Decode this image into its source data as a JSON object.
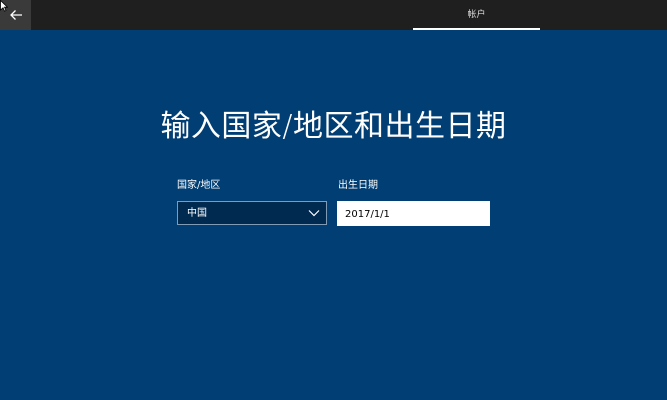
{
  "topbar": {
    "back_icon": "arrow-left-icon",
    "tab_label": "帐户"
  },
  "main": {
    "title": "输入国家/地区和出生日期",
    "country": {
      "label": "国家/地区",
      "selected_value": "中国",
      "dropdown_icon": "chevron-down-icon"
    },
    "birthdate": {
      "label": "出生日期",
      "value": "2017/1/1"
    }
  },
  "colors": {
    "background": "#003e73",
    "topbar": "#1f1f1f",
    "back_button": "#3a3a3a",
    "select_background": "#002a50",
    "select_border": "#7f9bb5",
    "input_background": "#ffffff",
    "text": "#ffffff"
  }
}
